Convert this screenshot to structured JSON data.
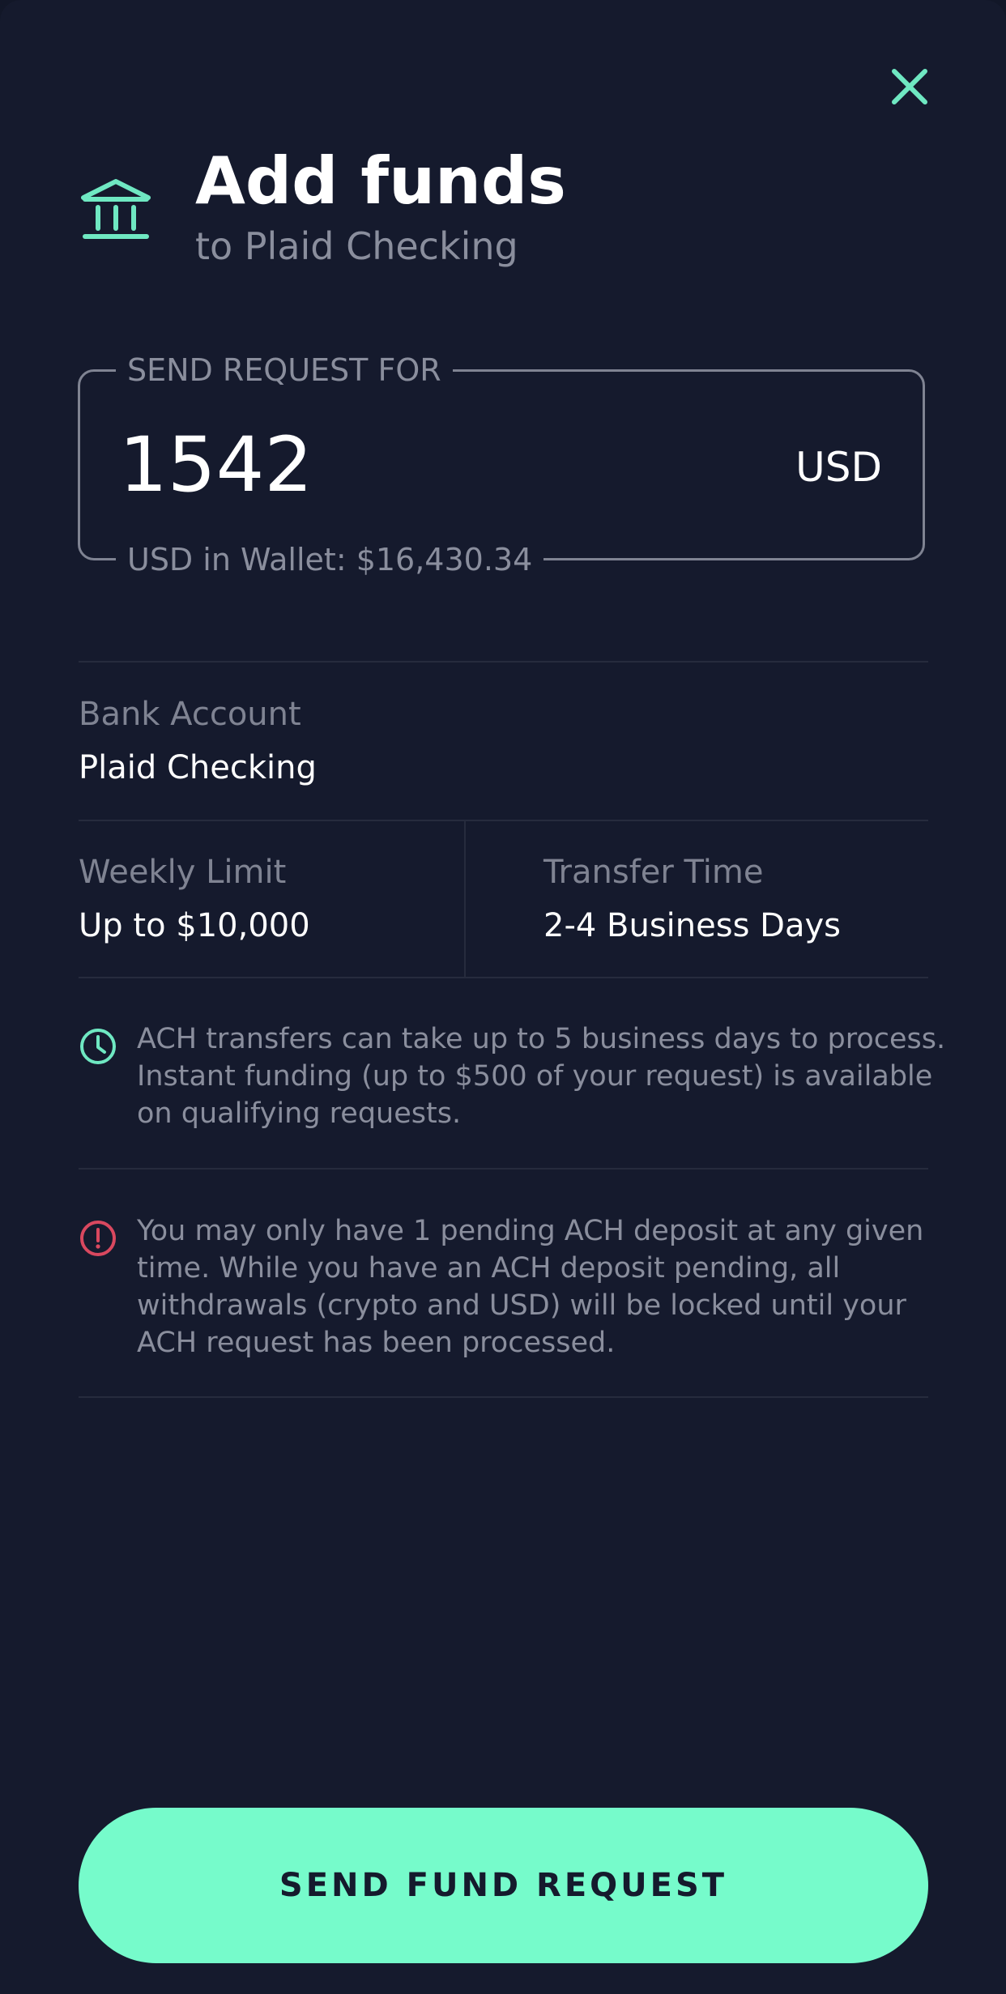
{
  "icons": {
    "close": "close-icon",
    "bank": "bank-icon",
    "clock": "clock-icon",
    "alert": "alert-circle-icon"
  },
  "colors": {
    "background": "#151a2d",
    "accent": "#76fbcb",
    "warning": "#d9485f",
    "muted_text": "#8a8e9d"
  },
  "header": {
    "title": "Add funds",
    "subtitle": "to Plaid Checking"
  },
  "amount": {
    "label": "SEND REQUEST FOR",
    "value": "1542",
    "currency": "USD",
    "wallet_balance": "USD in Wallet: $16,430.34"
  },
  "bank_account": {
    "label": "Bank Account",
    "value": "Plaid Checking"
  },
  "weekly_limit": {
    "label": "Weekly Limit",
    "value": "Up to $10,000"
  },
  "transfer_time": {
    "label": "Transfer Time",
    "value": "2-4 Business Days"
  },
  "notices": {
    "ach_timing": "ACH transfers can take up to 5 business days to process. Instant funding (up to $500 of your request) is available on qualifying requests.",
    "pending_limit": "You may only have 1 pending ACH deposit at any given time. While you have an ACH deposit pending, all withdrawals (crypto and USD) will be locked until your ACH request has been processed."
  },
  "actions": {
    "send_label": "SEND FUND REQUEST"
  }
}
